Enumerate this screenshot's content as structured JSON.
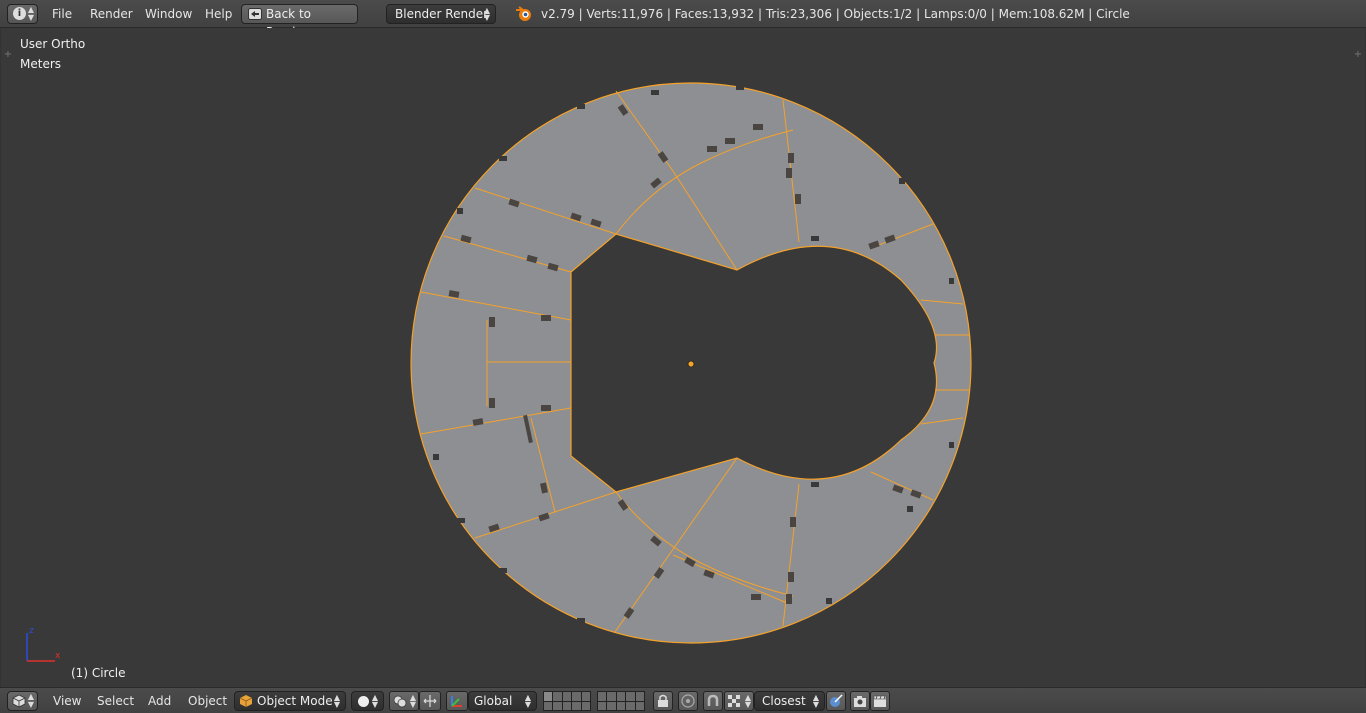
{
  "topbar": {
    "menus": [
      "File",
      "Render",
      "Window",
      "Help"
    ],
    "back_button": "Back to Previous",
    "render_engine": "Blender Render",
    "stats": "v2.79 | Verts:11,976 | Faces:13,932 | Tris:23,306 | Objects:1/2 | Lamps:0/0 | Mem:108.62M | Circle"
  },
  "viewport": {
    "view_name": "User Ortho",
    "units": "Meters",
    "object_label": "(1) Circle",
    "axis_labels": {
      "x": "x",
      "z": "z"
    },
    "colors": {
      "background": "#393939",
      "mesh_face": "#8d8f92",
      "selection": "#f5a22a"
    }
  },
  "bottombar": {
    "menus": [
      "View",
      "Select",
      "Add",
      "Object"
    ],
    "mode": "Object Mode",
    "orientation": "Global",
    "snap_target": "Closest"
  }
}
